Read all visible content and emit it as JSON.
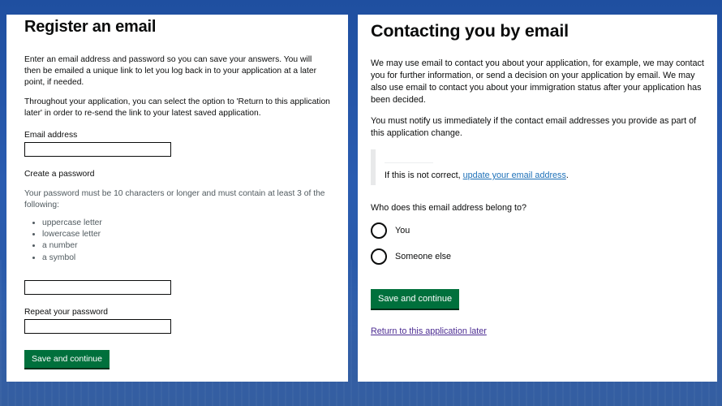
{
  "register": {
    "title": "Register an email",
    "intro": "Enter an email address and password so you can save your answers. You will then be emailed a unique link to let you log back in to your application at a later point, if needed.",
    "return_info": "Throughout your application, you can select the option to 'Return to this application later' in order to re-send the link to your latest saved application.",
    "email_label": "Email address",
    "email_value": "",
    "password_label": "Create a password",
    "password_hint": "Your password must be 10 characters or longer and must contain at least 3 of the following:",
    "password_rules": [
      "uppercase letter",
      "lowercase letter",
      "a number",
      "a symbol"
    ],
    "password_value": "",
    "repeat_label": "Repeat your password",
    "repeat_value": "",
    "submit_label": "Save and continue"
  },
  "contact": {
    "title": "Contacting you by email",
    "para1": "We may use email to contact you about your application, for example, we may contact you for further information, or send a decision on your application by email. We may also use email to contact you about your immigration status after your application has been decided.",
    "para2": "You must notify us immediately if the contact email addresses you provide as part of this application change.",
    "inset_prefix": "If this is not correct, ",
    "inset_link": "update your email address",
    "inset_suffix": ".",
    "question": "Who does this email address belong to?",
    "options": [
      "You",
      "Someone else"
    ],
    "submit_label": "Save and continue",
    "return_link": "Return to this application later"
  },
  "colors": {
    "button": "#00703c",
    "link": "#1d70b8",
    "visited_link": "#4c2c92",
    "background": "#2a5cb0"
  }
}
